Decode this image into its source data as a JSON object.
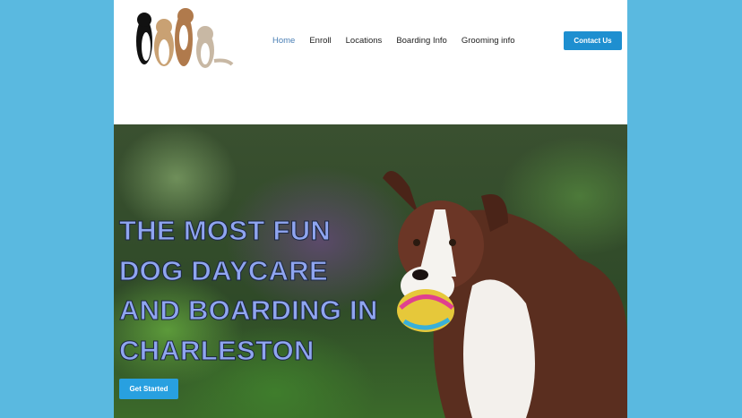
{
  "header": {
    "logo_alt": "four cartoon dogs logo",
    "nav": [
      "Home",
      "Enroll",
      "Locations",
      "Boarding Info",
      "Grooming info"
    ],
    "active_nav": "Home",
    "contact_label": "Contact Us"
  },
  "hero": {
    "title_lines": [
      "THE MOST FUN",
      "DOG DAYCARE",
      "AND BOARDING IN",
      "CHARLESTON"
    ],
    "cta_label": "Get Started"
  },
  "colors": {
    "side_background": "#5ab9e0",
    "accent": "#1e8fd0",
    "active_nav": "#4a7fb5",
    "hero_text": "#8fa5f0"
  }
}
